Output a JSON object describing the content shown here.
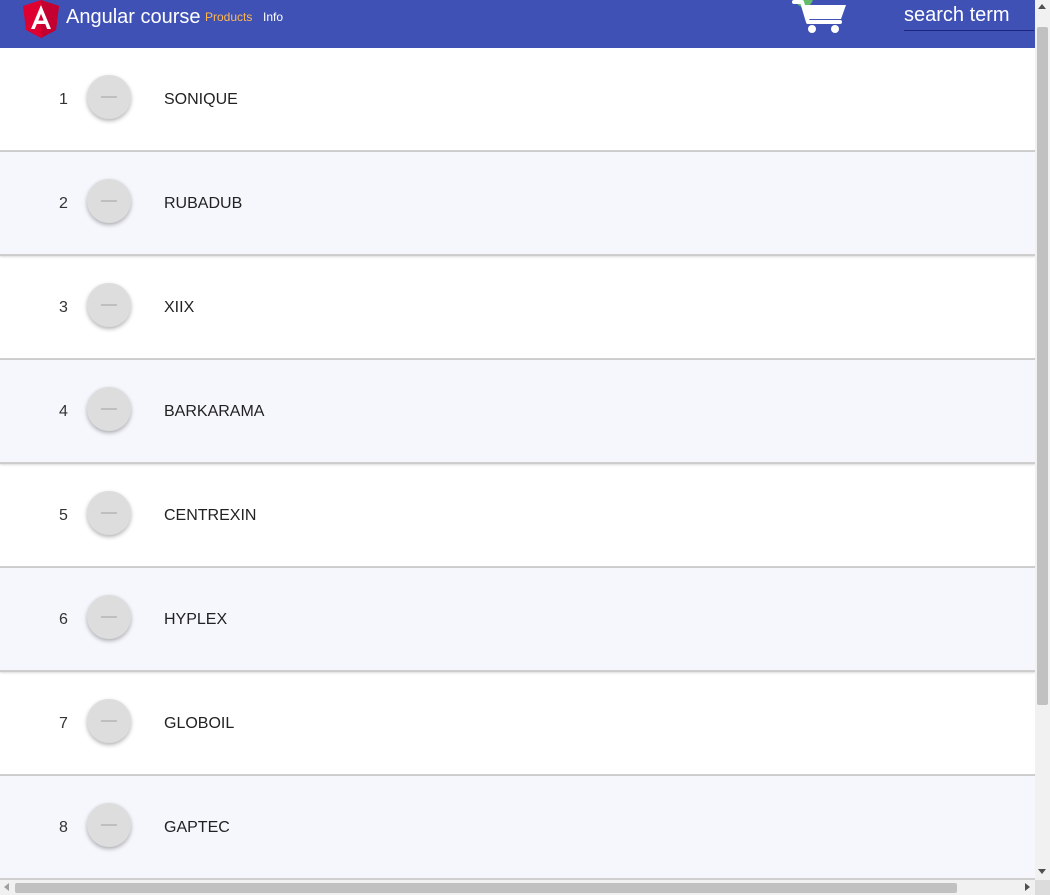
{
  "toolbar": {
    "title": "Angular course",
    "nav": [
      {
        "label": "Products",
        "active": true,
        "color": "#ffb74d"
      },
      {
        "label": "Info",
        "active": false
      }
    ],
    "cart_icon": "shopping-cart-icon",
    "search": {
      "placeholder": "search term",
      "value": ""
    },
    "background": "#3f51b5"
  },
  "products": [
    {
      "index": "1",
      "name": "SONIQUE"
    },
    {
      "index": "2",
      "name": "RUBADUB"
    },
    {
      "index": "3",
      "name": "XIIX"
    },
    {
      "index": "4",
      "name": "BARKARAMA"
    },
    {
      "index": "5",
      "name": "CENTREXIN"
    },
    {
      "index": "6",
      "name": "HYPLEX"
    },
    {
      "index": "7",
      "name": "GLOBOIL"
    },
    {
      "index": "8",
      "name": "GAPTEC"
    }
  ]
}
